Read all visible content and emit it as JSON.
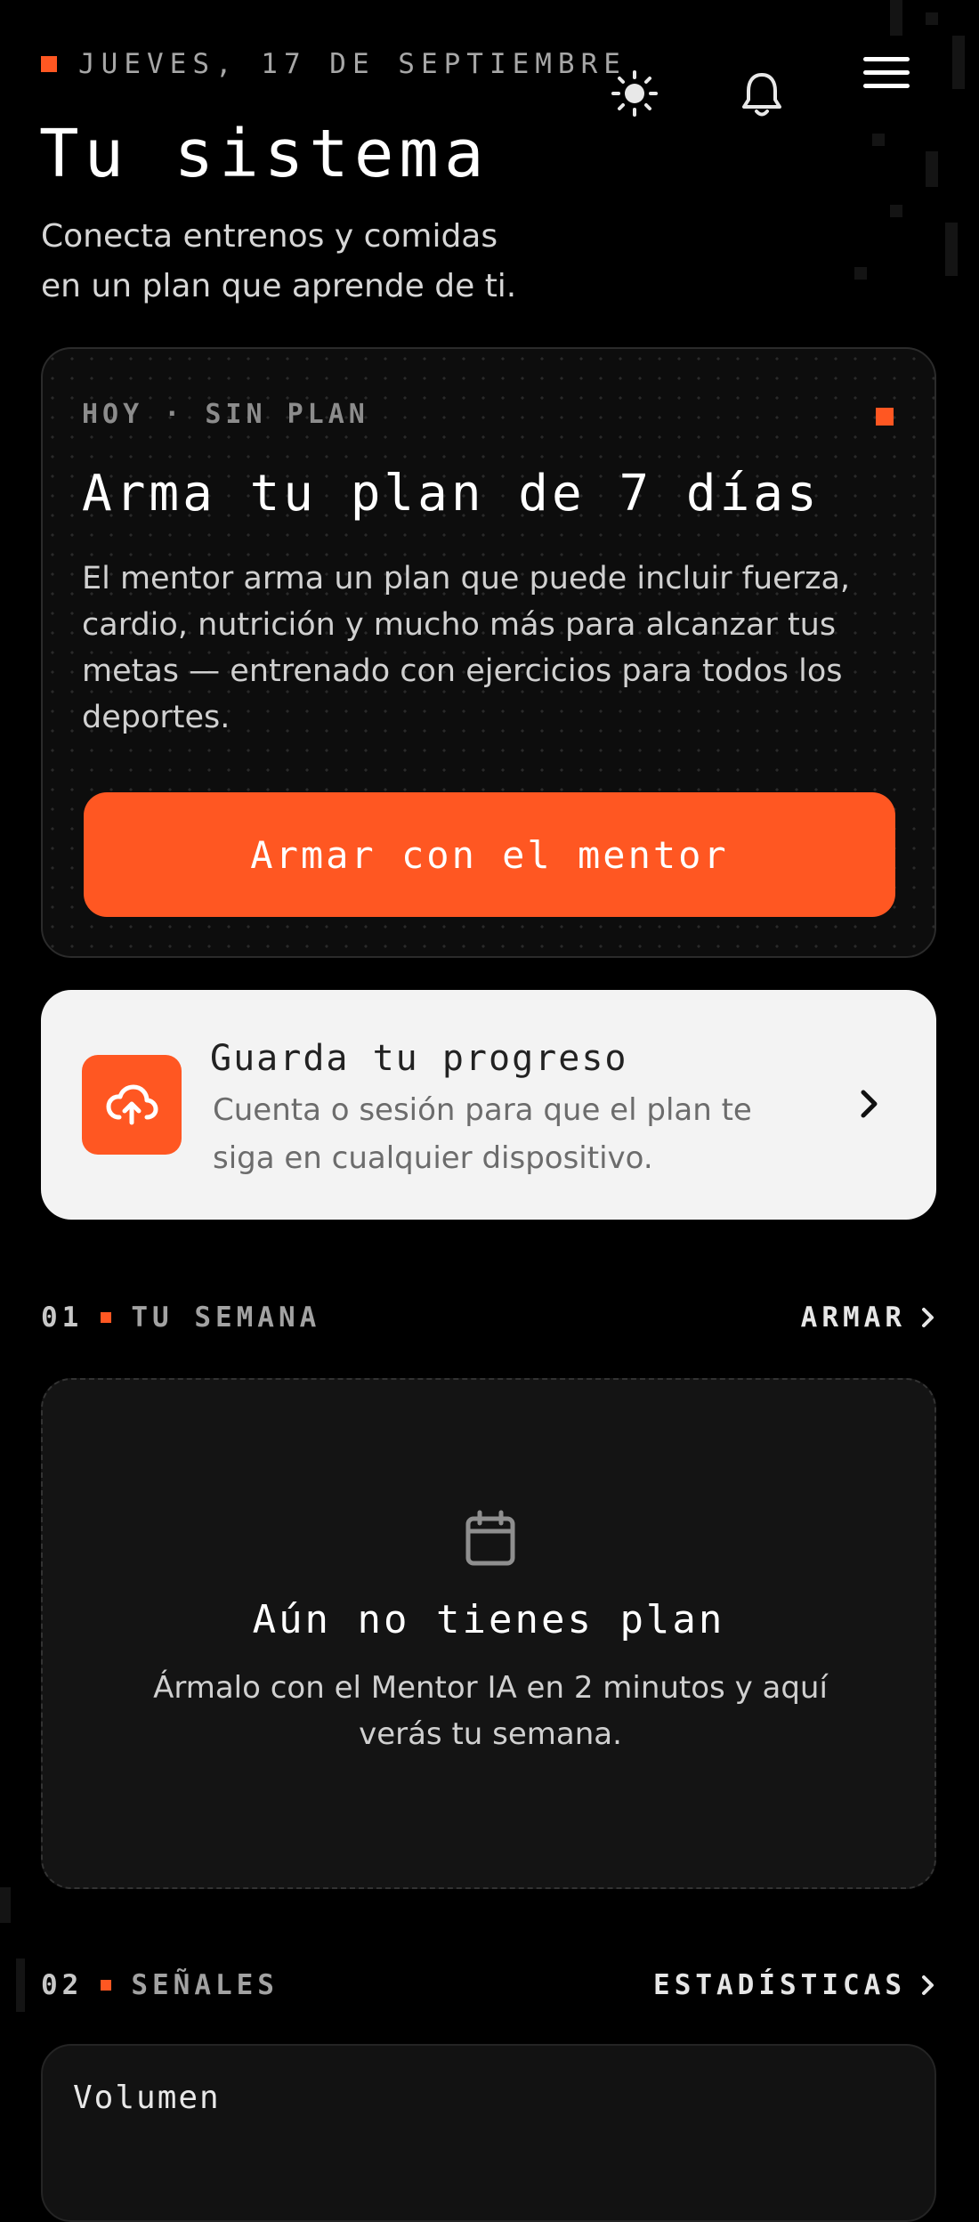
{
  "colors": {
    "accent": "#ff5722",
    "background": "#000000",
    "save_card_bg": "#f3f3f3"
  },
  "header": {
    "date": "JUEVES, 17 DE SEPTIEMBRE",
    "icons": [
      "sun-icon",
      "bell-icon",
      "menu-icon"
    ]
  },
  "page": {
    "title": "Tu sistema",
    "subtitle_line1": "Conecta entrenos y comidas",
    "subtitle_line2": "en un plan que aprende de ti."
  },
  "plan_card": {
    "eyebrow": "HOY · SIN PLAN",
    "title": "Arma tu plan de 7 días",
    "description": "El mentor arma un plan que puede incluir fuerza, cardio, nutrición y mucho más para alcanzar tus metas — entrenado con ejercicios para todos los deportes.",
    "button_label": "Armar con el mentor"
  },
  "save_card": {
    "icon": "cloud-upload-icon",
    "title": "Guarda tu progreso",
    "description": "Cuenta o sesión para que el plan te siga en cualquier dispositivo."
  },
  "sections": {
    "week": {
      "number": "01",
      "label": "TU SEMANA",
      "link": "ARMAR",
      "empty_title": "Aún no tienes plan",
      "empty_desc": "Ármalo con el Mentor IA en 2 minutos y aquí verás tu semana."
    },
    "signals": {
      "number": "02",
      "label": "SEÑALES",
      "link": "ESTADÍSTICAS",
      "metric_label": "Volumen"
    }
  }
}
